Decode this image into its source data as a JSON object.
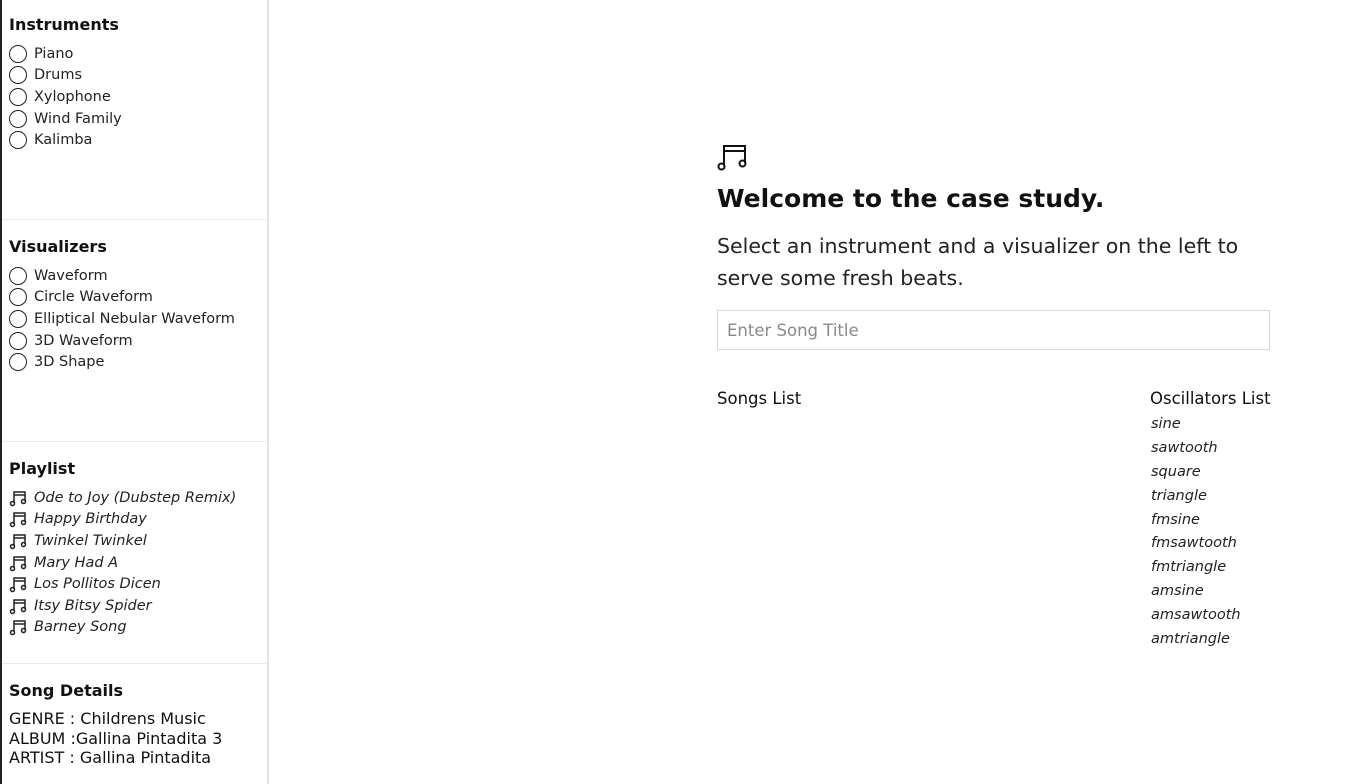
{
  "sidebar": {
    "instruments": {
      "title": "Instruments",
      "items": [
        "Piano",
        "Drums",
        "Xylophone",
        "Wind Family",
        "Kalimba"
      ]
    },
    "visualizers": {
      "title": "Visualizers",
      "items": [
        "Waveform",
        "Circle Waveform",
        "Elliptical Nebular Waveform",
        "3D Waveform",
        "3D Shape"
      ]
    },
    "playlist": {
      "title": "Playlist",
      "items": [
        "Ode to Joy (Dubstep Remix)",
        "Happy Birthday",
        "Twinkel Twinkel",
        "Mary Had A",
        "Los Pollitos Dicen",
        "Itsy Bitsy Spider",
        "Barney Song"
      ]
    },
    "song_details": {
      "title": "Song Details",
      "genre": "GENRE : Childrens Music",
      "album": "ALBUM :Gallina Pintadita 3",
      "artist": "ARTIST : Gallina Pintadita"
    }
  },
  "main": {
    "title": "Welcome to the case study.",
    "subtitle": "Select an instrument and a visualizer on the left to serve some fresh beats.",
    "song_input": {
      "placeholder": "Enter Song Title",
      "value": ""
    },
    "songs_list_label": "Songs List",
    "oscillators_label": "Oscillators List",
    "oscillators": [
      "sine",
      "sawtooth",
      "square",
      "triangle",
      "fmsine",
      "fmsawtooth",
      "fmtriangle",
      "amsine",
      "amsawtooth",
      "amtriangle"
    ]
  },
  "icons": {
    "radio": "radio-unchecked-icon",
    "music": "music-note-icon"
  }
}
